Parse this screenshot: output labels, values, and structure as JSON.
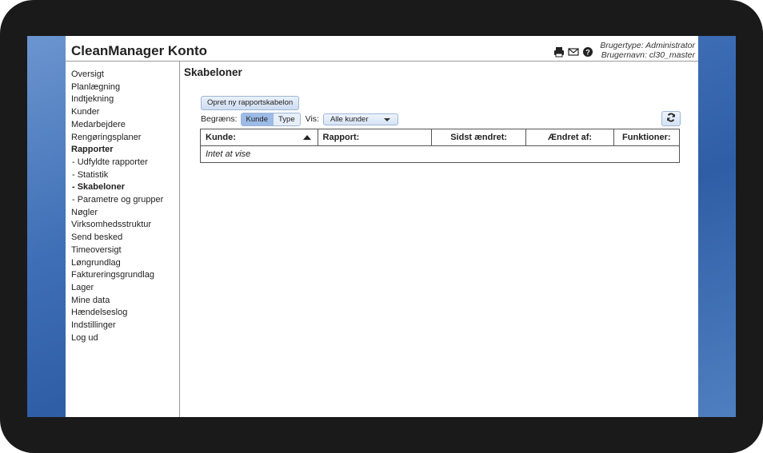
{
  "app": {
    "title": "CleanManager Konto",
    "user_type": "Brugertype: Administrator",
    "user_name": "Brugernavn: cl30_master"
  },
  "header_icons": [
    "print-icon",
    "mail-icon",
    "help-icon"
  ],
  "sidebar": {
    "items": [
      {
        "label": "Oversigt"
      },
      {
        "label": "Planlægning"
      },
      {
        "label": "Indtjekning"
      },
      {
        "label": "Kunder"
      },
      {
        "label": "Medarbejdere"
      },
      {
        "label": "Rengøringsplaner"
      },
      {
        "label": "Rapporter",
        "bold": true
      },
      {
        "label": "- Udfyldte rapporter"
      },
      {
        "label": "- Statistik"
      },
      {
        "label": "- Skabeloner",
        "bold": true
      },
      {
        "label": "- Parametre og grupper"
      },
      {
        "label": "Nøgler"
      },
      {
        "label": "Virksomhedsstruktur"
      },
      {
        "label": "Send besked"
      },
      {
        "label": "Timeoversigt"
      },
      {
        "label": "Løngrundlag"
      },
      {
        "label": "Faktureringsgrundlag"
      },
      {
        "label": "Lager"
      },
      {
        "label": "Mine data"
      },
      {
        "label": "Hændelseslog"
      },
      {
        "label": "Indstillinger"
      },
      {
        "label": "Log ud"
      }
    ]
  },
  "main": {
    "title": "Skabeloner",
    "new_button": "Opret ny rapportskabelon",
    "filter_label": "Begræns:",
    "filter_options": [
      "Kunde",
      "Type"
    ],
    "filter_active": "Kunde",
    "vis_label": "Vis:",
    "vis_selected": "Alle kunder",
    "table": {
      "columns": [
        "Kunde:",
        "Rapport:",
        "Sidst ændret:",
        "Ændret af:",
        "Funktioner:"
      ],
      "empty_text": "Intet at vise"
    }
  }
}
